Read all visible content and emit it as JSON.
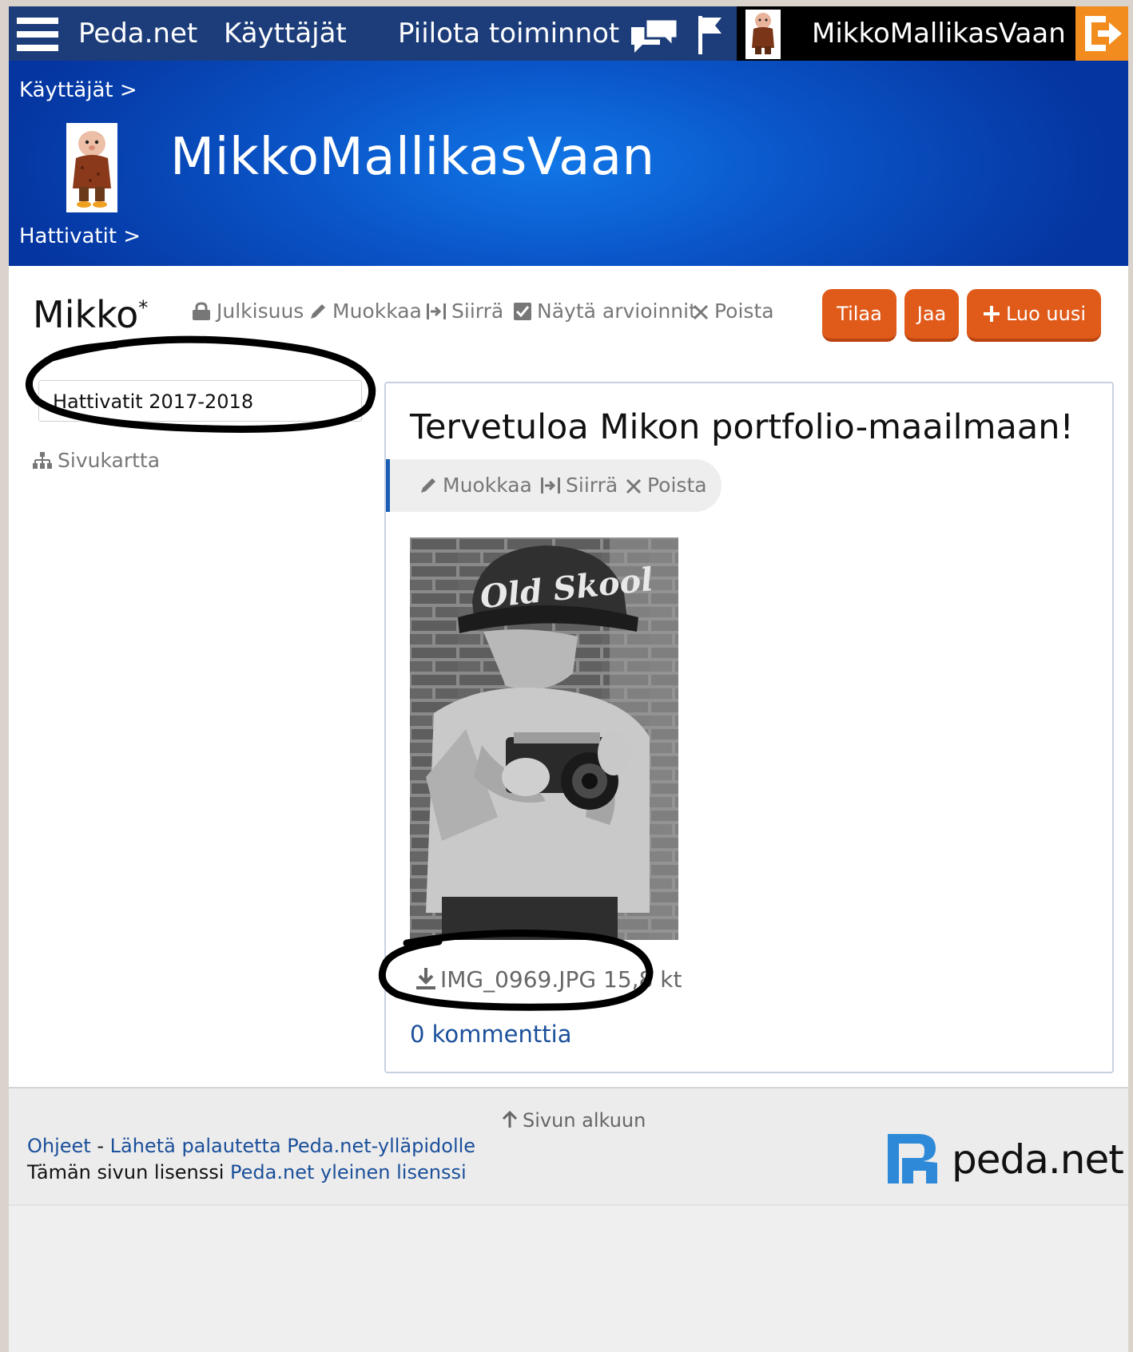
{
  "topbar": {
    "site": "Peda.net",
    "users": "Käyttäjät",
    "hide_functions": "Piilota toiminnot",
    "username": "MikkoMallikasVaan",
    "icons": [
      "menu-icon",
      "chat-icon",
      "flag-icon",
      "logout-icon"
    ]
  },
  "header": {
    "breadcrumb_1": "Käyttäjät >",
    "title": "MikkoMallikasVaan",
    "breadcrumb_2": "Hattivatit >"
  },
  "page": {
    "title": "Mikko",
    "title_mark": "*",
    "tools": {
      "publicity": "Julkisuus",
      "edit": "Muokkaa",
      "move": "Siirrä",
      "show_ratings": "Näytä arvioinnit",
      "delete": "Poista"
    },
    "buttons": {
      "subscribe": "Tilaa",
      "share": "Jaa",
      "create_new": "Luo uusi"
    }
  },
  "sidebar": {
    "nav_item": "Hattivatit 2017-2018",
    "sitemap": "Sivukartta"
  },
  "card": {
    "title": "Tervetuloa Mikon portfolio-maailmaan!",
    "tools": {
      "edit": "Muokkaa",
      "move": "Siirrä",
      "delete": "Poista"
    },
    "image_cap_text": "Old Skool",
    "file_name": "IMG_0969.JPG",
    "file_size": "15,8 kt",
    "comments": "0 kommenttia"
  },
  "footer": {
    "to_top": "Sivun alkuun",
    "help": "Ohjeet",
    "separator": " - ",
    "feedback": "Lähetä palautetta Peda.net-ylläpidolle",
    "license_prefix": "Tämän sivun lisenssi ",
    "license_link": "Peda.net yleinen lisenssi",
    "logo_text": "peda.net"
  },
  "colors": {
    "topbar": "#1d3d7a",
    "header_blue": "#0a55c8",
    "accent_orange": "#e05a1a",
    "logout_orange": "#f28c1f",
    "link_blue": "#1a4f9a"
  }
}
